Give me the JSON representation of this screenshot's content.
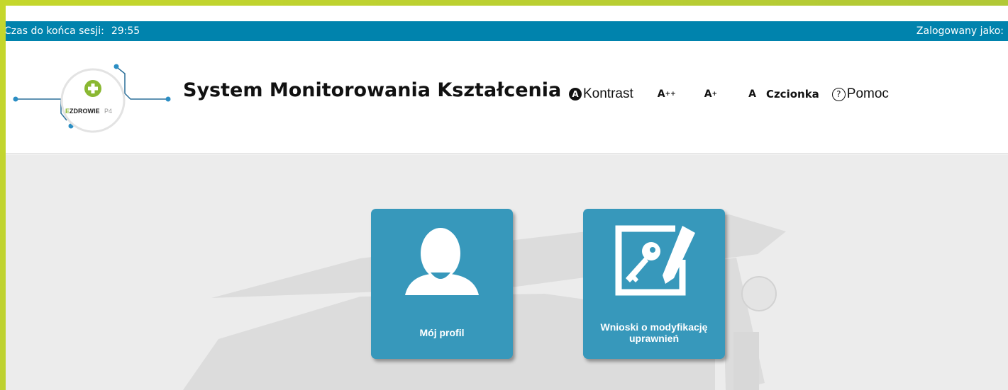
{
  "session": {
    "timer_label": "Czas do końca sesji:",
    "timer_value": "29:55",
    "logged_label": "Zalogowany jako:"
  },
  "logo": {
    "text_main": "EZDROWIE",
    "text_suffix": "P4"
  },
  "header": {
    "title": "System Monitorowania Kształcenia"
  },
  "toolbar": {
    "contrast_icon": "A",
    "contrast_label": "Kontrast",
    "font_large": "A",
    "font_large_sup": "++",
    "font_medium": "A",
    "font_medium_sup": "+",
    "font_normal": "A",
    "font_label": "Czcionka",
    "help_icon": "?",
    "help_label": "Pomoc"
  },
  "tiles": [
    {
      "label": "Mój profil",
      "icon": "user-icon"
    },
    {
      "label": "Wnioski o modyfikację uprawnień",
      "icon": "key-document-icon"
    }
  ],
  "colors": {
    "session_bar": "#0083ad",
    "tile": "#3798bb",
    "outer_border": "#c5d72c",
    "content_bg": "#ececec"
  }
}
